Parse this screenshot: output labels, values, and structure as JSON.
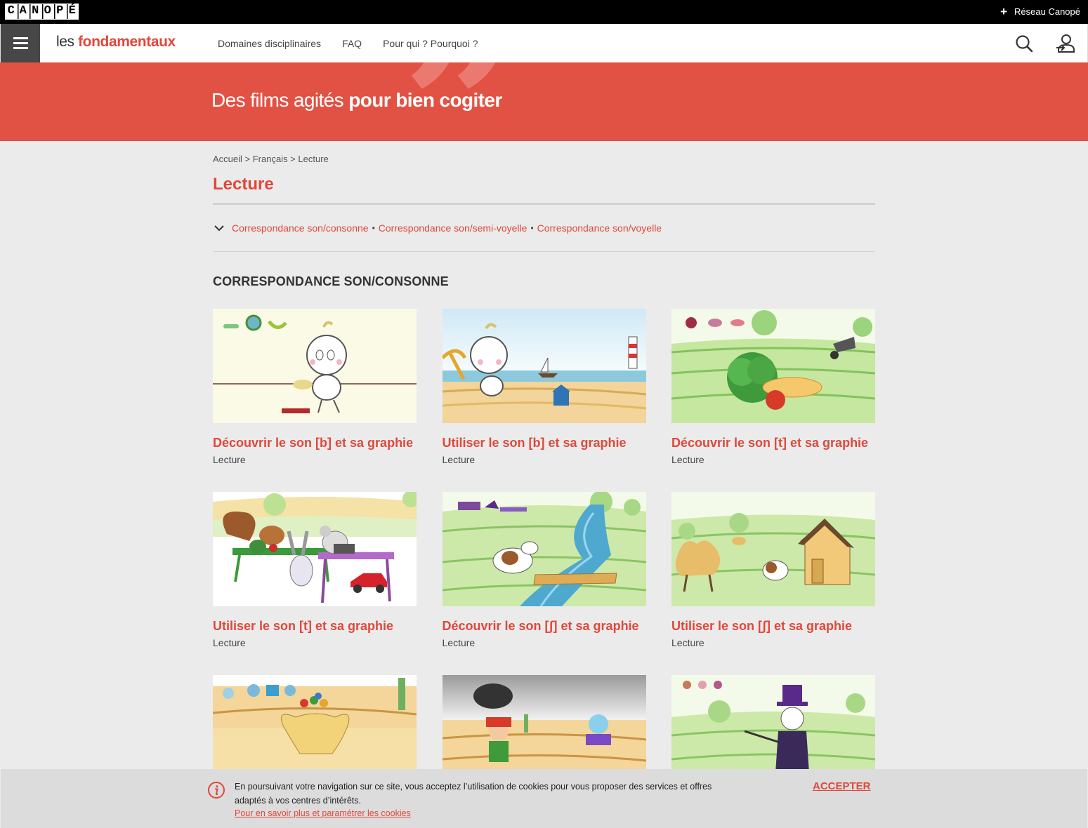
{
  "topbar": {
    "logo_letters": [
      "C",
      "A",
      "N",
      "O",
      "P",
      "É"
    ],
    "reseau_plus": "+",
    "reseau_label": "Réseau Canopé"
  },
  "header": {
    "brand_les": "les ",
    "brand_fondamentaux": "fondamentaux",
    "nav": [
      "Domaines disciplinaires",
      "FAQ",
      "Pour qui ? Pourquoi ?"
    ],
    "icons": [
      "search-icon",
      "account-login-icon"
    ]
  },
  "hero": {
    "tagline_regular": "Des films agités ",
    "tagline_bold": "pour bien cogiter"
  },
  "breadcrumb": "Accueil > Français > Lecture",
  "page_title": "Lecture",
  "subnav": {
    "links": [
      "Correspondance son/consonne",
      "Correspondance son/semi-voyelle",
      "Correspondance son/voyelle"
    ],
    "separator": "•"
  },
  "section_title": "CORRESPONDANCE SON/CONSONNE",
  "cards": [
    {
      "title": "Découvrir le son [b] et sa graphie",
      "subtitle": "Lecture"
    },
    {
      "title": "Utiliser le son [b] et sa graphie",
      "subtitle": "Lecture"
    },
    {
      "title": "Découvrir le son [t] et sa graphie",
      "subtitle": "Lecture"
    },
    {
      "title": "Utiliser le son [t] et sa graphie",
      "subtitle": "Lecture"
    },
    {
      "title": "Découvrir le son [ʃ] et sa graphie",
      "subtitle": "Lecture"
    },
    {
      "title": "Utiliser le son [ʃ] et sa graphie",
      "subtitle": "Lecture"
    }
  ],
  "cookie": {
    "message": "En poursuivant votre navigation sur ce site, vous acceptez l’utilisation de cookies pour vous proposer des services et offres adaptés à vos centres d’intérêts.",
    "more_link": "Pour en savoir plus et paramétrer les cookies",
    "accept": "ACCEPTER"
  },
  "colors": {
    "accent": "#e1473a",
    "hero": "#e15244",
    "topbar": "#000000",
    "page_bg": "#ebebeb"
  }
}
